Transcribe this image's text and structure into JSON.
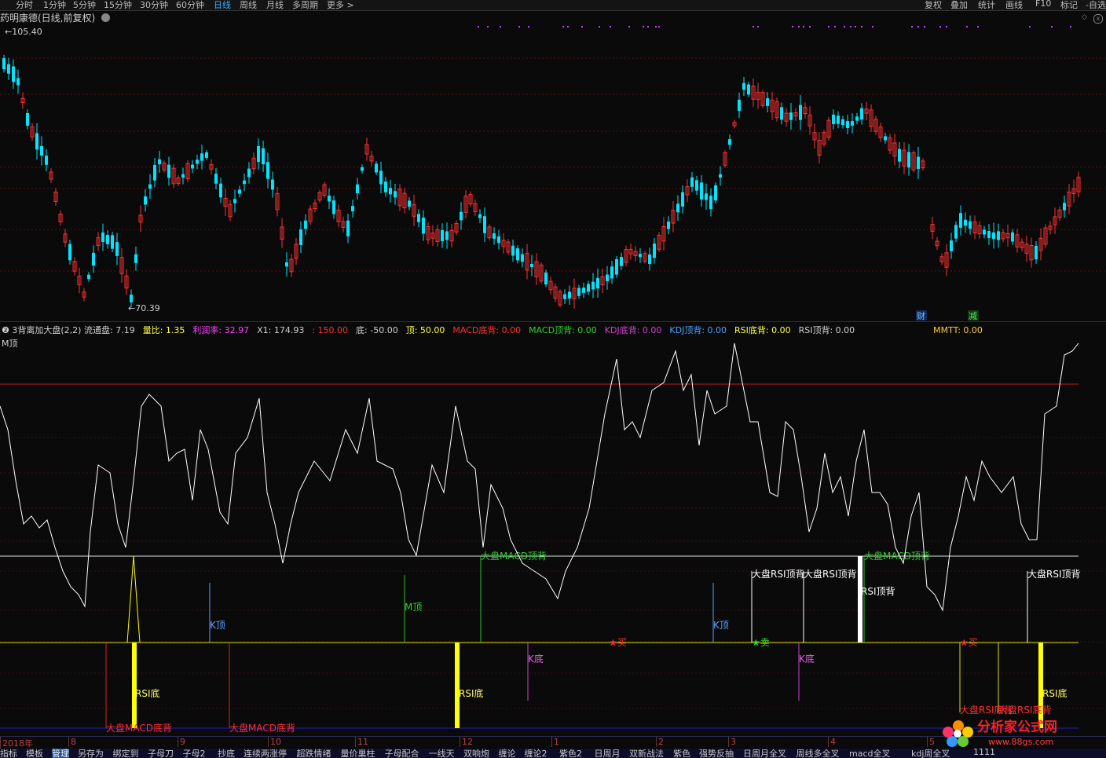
{
  "toolbar": {
    "periods": [
      "分时",
      "1分钟",
      "5分钟",
      "15分钟",
      "30分钟",
      "60分钟",
      "日线",
      "周线",
      "月线",
      "多周期",
      "更多 >"
    ],
    "active_period": "日线",
    "right": [
      "复权",
      "叠加",
      "统计",
      "画线",
      "F10",
      "标记",
      "-自选"
    ]
  },
  "title": "药明康德(日线,前复权)",
  "price": {
    "high_label": "105.40",
    "low_label": "70.39",
    "badge_cai": "财",
    "badge_jian": "减"
  },
  "indicator": {
    "name": "3背离加大盘(2,2)",
    "fields": [
      {
        "label": "流通盘:",
        "value": "7.19",
        "color": "#d0d0d0"
      },
      {
        "label": "量比:",
        "value": "1.35",
        "color": "#ffff44"
      },
      {
        "label": "利润率:",
        "value": "32.97",
        "color": "#ff44ff"
      },
      {
        "label": "X1:",
        "value": "174.93",
        "color": "#d0d0d0"
      },
      {
        "label": ":",
        "value": "150.00",
        "color": "#ff3030"
      },
      {
        "label": "底:",
        "value": "-50.00",
        "color": "#d0d0d0"
      },
      {
        "label": "顶:",
        "value": "50.00",
        "color": "#ffff44"
      },
      {
        "label": "MACD底背:",
        "value": "0.00",
        "color": "#ff3030"
      },
      {
        "label": "MACD顶背:",
        "value": "0.00",
        "color": "#30d030"
      },
      {
        "label": "KDJ底背:",
        "value": "0.00",
        "color": "#d040d0"
      },
      {
        "label": "KDJ顶背:",
        "value": "0.00",
        "color": "#50a0ff"
      },
      {
        "label": "RSI底背:",
        "value": "0.00",
        "color": "#ffff44"
      },
      {
        "label": "RSI顶背:",
        "value": "0.00",
        "color": "#d0d0d0"
      },
      {
        "label": "MMTT:",
        "value": "0.00",
        "color": "#ffcc44"
      }
    ],
    "m_top": "M顶"
  },
  "signals": {
    "m_top": "M顶",
    "k_top": "K顶",
    "k_bottom": "K底",
    "rsi_bottom": "RSI底",
    "rsi_top_div": "RSI顶背",
    "market_macd_bottom": "大盘MACD底背",
    "market_macd_top": "大盘MACD顶背",
    "market_rsi_top": "大盘RSI顶背",
    "market_rsi_bottom": "大盘RSI底背",
    "buy": "★买",
    "sell": "★卖"
  },
  "date_axis": [
    "2018年",
    "8",
    "9",
    "10",
    "11",
    "12",
    "1",
    "2",
    "3",
    "4",
    "5"
  ],
  "bottom_tabs": [
    "指标",
    "模板",
    "管理",
    "另存为",
    "绑定到",
    "子母刀",
    "子母2",
    "抄底",
    "连续两涨停",
    "超跌情绪",
    "量价巢柱",
    "子母配合",
    "一线天",
    "双响炮",
    "缠论",
    "缠论2",
    "紫色2",
    "日周月",
    "双新战法",
    "紫色",
    "强势反抽",
    "日周月全叉",
    "周线多全叉",
    "macd全叉",
    "kdj周全叉",
    "1111"
  ],
  "active_tab": "管理",
  "watermark": {
    "main": "分析家公式网",
    "url": "www.88gs.com"
  },
  "colors": {
    "up": "#ff3030",
    "down": "#00e5ff",
    "yellow": "#ffff00",
    "white": "#ffffff",
    "accent": "#3ab0ff"
  }
}
